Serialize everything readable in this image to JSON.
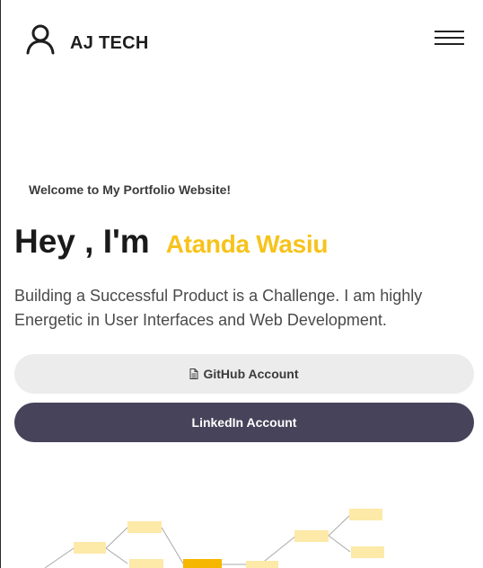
{
  "header": {
    "brand": "AJ TECH",
    "icons": {
      "logo": "user-outline-icon",
      "menu": "hamburger-menu-icon"
    }
  },
  "hero": {
    "welcome": "Welcome to My Portfolio Website!",
    "greeting": "Hey , I'm",
    "name": "Atanda Wasiu",
    "bio": "Building a Successful Product is a Challenge. I am highly Energetic in User Interfaces and Web Development."
  },
  "buttons": {
    "github": {
      "label": "GitHub Account",
      "icon": "document-icon"
    },
    "linkedin": {
      "label": "LinkedIn Account"
    }
  },
  "colors": {
    "accent": "#f7c31b",
    "button_dark": "#46435a",
    "button_light": "#ececec",
    "node_light": "#fde9a8",
    "node_strong": "#f5b700"
  }
}
